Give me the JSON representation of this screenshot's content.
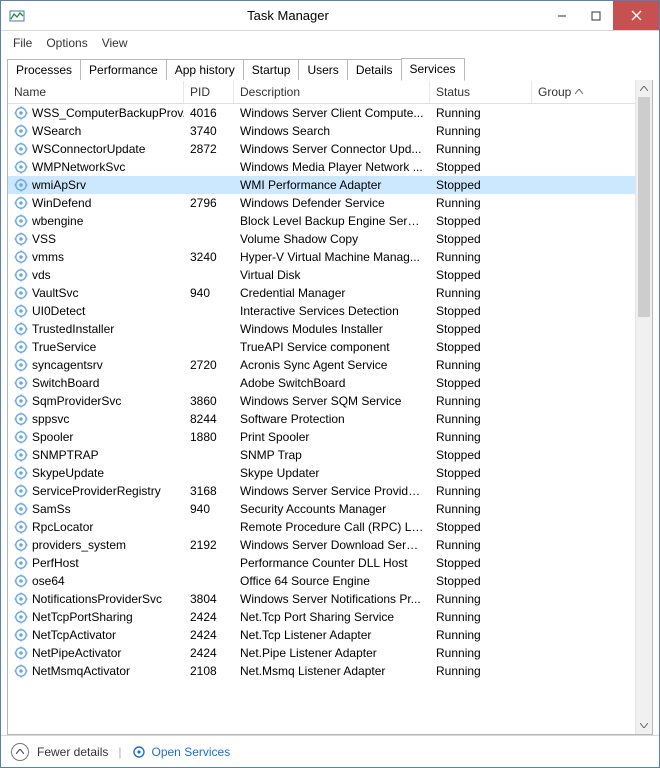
{
  "window": {
    "title": "Task Manager"
  },
  "menu": {
    "items": [
      "File",
      "Options",
      "View"
    ]
  },
  "tabs": {
    "items": [
      "Processes",
      "Performance",
      "App history",
      "Startup",
      "Users",
      "Details",
      "Services"
    ],
    "active_index": 6
  },
  "columns": {
    "name": "Name",
    "pid": "PID",
    "description": "Description",
    "status": "Status",
    "group": "Group"
  },
  "sort": {
    "column": "group",
    "direction": "asc"
  },
  "selected_index": 4,
  "services": [
    {
      "name": "WSS_ComputerBackupProv...",
      "pid": "4016",
      "description": "Windows Server Client Compute...",
      "status": "Running",
      "group": ""
    },
    {
      "name": "WSearch",
      "pid": "3740",
      "description": "Windows Search",
      "status": "Running",
      "group": ""
    },
    {
      "name": "WSConnectorUpdate",
      "pid": "2872",
      "description": "Windows Server Connector Upd...",
      "status": "Running",
      "group": ""
    },
    {
      "name": "WMPNetworkSvc",
      "pid": "",
      "description": "Windows Media Player Network ...",
      "status": "Stopped",
      "group": ""
    },
    {
      "name": "wmiApSrv",
      "pid": "",
      "description": "WMI Performance Adapter",
      "status": "Stopped",
      "group": ""
    },
    {
      "name": "WinDefend",
      "pid": "2796",
      "description": "Windows Defender Service",
      "status": "Running",
      "group": ""
    },
    {
      "name": "wbengine",
      "pid": "",
      "description": "Block Level Backup Engine Service",
      "status": "Stopped",
      "group": ""
    },
    {
      "name": "VSS",
      "pid": "",
      "description": "Volume Shadow Copy",
      "status": "Stopped",
      "group": ""
    },
    {
      "name": "vmms",
      "pid": "3240",
      "description": "Hyper-V Virtual Machine Manag...",
      "status": "Running",
      "group": ""
    },
    {
      "name": "vds",
      "pid": "",
      "description": "Virtual Disk",
      "status": "Stopped",
      "group": ""
    },
    {
      "name": "VaultSvc",
      "pid": "940",
      "description": "Credential Manager",
      "status": "Running",
      "group": ""
    },
    {
      "name": "UI0Detect",
      "pid": "",
      "description": "Interactive Services Detection",
      "status": "Stopped",
      "group": ""
    },
    {
      "name": "TrustedInstaller",
      "pid": "",
      "description": "Windows Modules Installer",
      "status": "Stopped",
      "group": ""
    },
    {
      "name": "TrueService",
      "pid": "",
      "description": "TrueAPI Service component",
      "status": "Stopped",
      "group": ""
    },
    {
      "name": "syncagentsrv",
      "pid": "2720",
      "description": "Acronis Sync Agent Service",
      "status": "Running",
      "group": ""
    },
    {
      "name": "SwitchBoard",
      "pid": "",
      "description": "Adobe SwitchBoard",
      "status": "Stopped",
      "group": ""
    },
    {
      "name": "SqmProviderSvc",
      "pid": "3860",
      "description": "Windows Server SQM Service",
      "status": "Running",
      "group": ""
    },
    {
      "name": "sppsvc",
      "pid": "8244",
      "description": "Software Protection",
      "status": "Running",
      "group": ""
    },
    {
      "name": "Spooler",
      "pid": "1880",
      "description": "Print Spooler",
      "status": "Running",
      "group": ""
    },
    {
      "name": "SNMPTRAP",
      "pid": "",
      "description": "SNMP Trap",
      "status": "Stopped",
      "group": ""
    },
    {
      "name": "SkypeUpdate",
      "pid": "",
      "description": "Skype Updater",
      "status": "Stopped",
      "group": ""
    },
    {
      "name": "ServiceProviderRegistry",
      "pid": "3168",
      "description": "Windows Server Service Provider...",
      "status": "Running",
      "group": ""
    },
    {
      "name": "SamSs",
      "pid": "940",
      "description": "Security Accounts Manager",
      "status": "Running",
      "group": ""
    },
    {
      "name": "RpcLocator",
      "pid": "",
      "description": "Remote Procedure Call (RPC) Lo...",
      "status": "Stopped",
      "group": ""
    },
    {
      "name": "providers_system",
      "pid": "2192",
      "description": "Windows Server Download Service",
      "status": "Running",
      "group": ""
    },
    {
      "name": "PerfHost",
      "pid": "",
      "description": "Performance Counter DLL Host",
      "status": "Stopped",
      "group": ""
    },
    {
      "name": "ose64",
      "pid": "",
      "description": "Office 64 Source Engine",
      "status": "Stopped",
      "group": ""
    },
    {
      "name": "NotificationsProviderSvc",
      "pid": "3804",
      "description": "Windows Server Notifications Pr...",
      "status": "Running",
      "group": ""
    },
    {
      "name": "NetTcpPortSharing",
      "pid": "2424",
      "description": "Net.Tcp Port Sharing Service",
      "status": "Running",
      "group": ""
    },
    {
      "name": "NetTcpActivator",
      "pid": "2424",
      "description": "Net.Tcp Listener Adapter",
      "status": "Running",
      "group": ""
    },
    {
      "name": "NetPipeActivator",
      "pid": "2424",
      "description": "Net.Pipe Listener Adapter",
      "status": "Running",
      "group": ""
    },
    {
      "name": "NetMsmqActivator",
      "pid": "2108",
      "description": "Net.Msmq Listener Adapter",
      "status": "Running",
      "group": ""
    }
  ],
  "footer": {
    "fewer": "Fewer details",
    "open_services": "Open Services"
  }
}
